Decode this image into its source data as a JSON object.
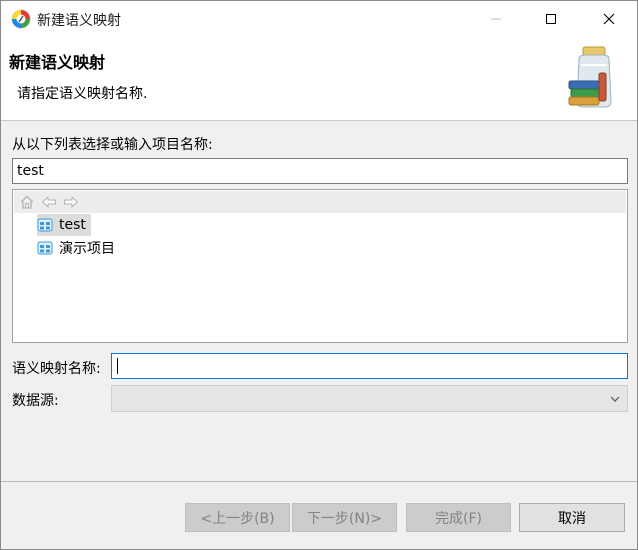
{
  "window": {
    "title": "新建语义映射",
    "controls": {
      "minimize": "minimize-icon",
      "maximize": "maximize-icon",
      "close": "close-icon"
    }
  },
  "header": {
    "title": "新建语义映射",
    "description": "请指定语义映射名称."
  },
  "project_list": {
    "label": "从以下列表选择或输入项目名称:",
    "filter_value": "test",
    "toolbar_icons": [
      "home-icon",
      "back-arrow-icon",
      "forward-arrow-icon"
    ],
    "items": [
      {
        "label": "test",
        "selected": true
      },
      {
        "label": "演示项目",
        "selected": false
      }
    ]
  },
  "form": {
    "name_label": "语义映射名称:",
    "name_value": "",
    "datasource_label": "数据源:",
    "datasource_value": ""
  },
  "buttons": {
    "back": "<上一步(B)",
    "next": "下一步(N)>",
    "finish": "完成(F)",
    "cancel": "取消"
  },
  "colors": {
    "accent": "#0078d7",
    "selection": "#dcdcdc",
    "disabled_button": "#cccccc"
  }
}
